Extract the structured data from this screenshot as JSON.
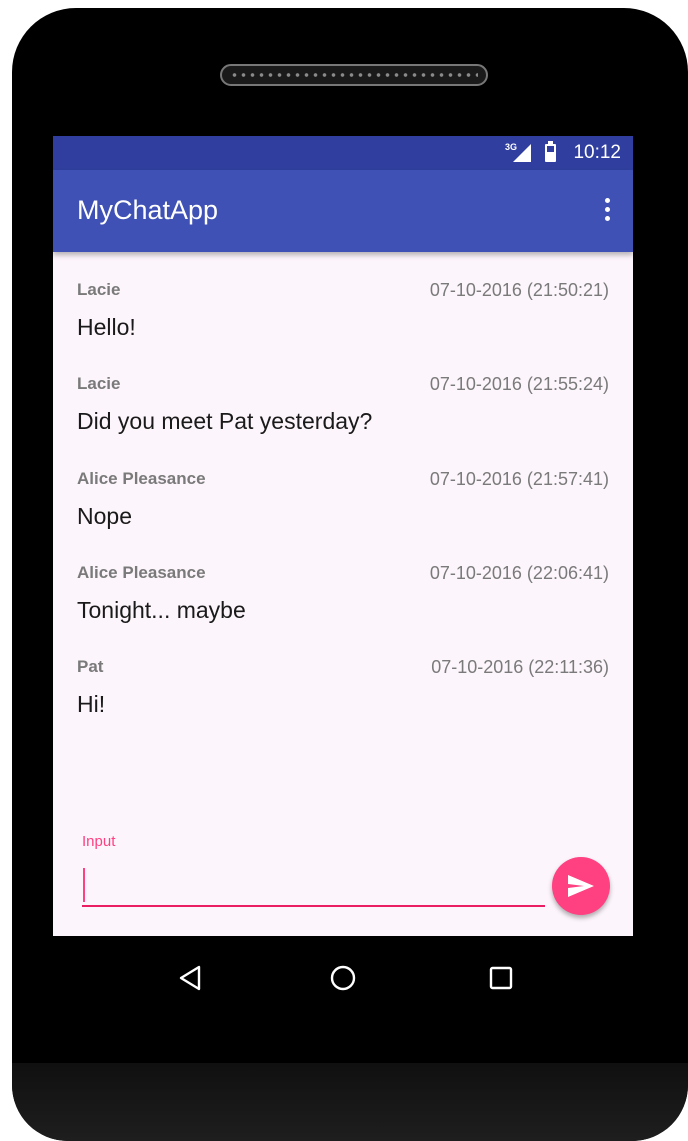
{
  "status_bar": {
    "network": "3G",
    "time": "10:12"
  },
  "app_bar": {
    "title": "MyChatApp",
    "overflow_icon": "more-vert-icon"
  },
  "messages": [
    {
      "sender": "Lacie",
      "timestamp": "07-10-2016 (21:50:21)",
      "text": "Hello!"
    },
    {
      "sender": "Lacie",
      "timestamp": "07-10-2016 (21:55:24)",
      "text": "Did you meet Pat yesterday?"
    },
    {
      "sender": "Alice Pleasance",
      "timestamp": "07-10-2016 (21:57:41)",
      "text": "Nope"
    },
    {
      "sender": "Alice Pleasance",
      "timestamp": "07-10-2016 (22:06:41)",
      "text": "Tonight... maybe"
    },
    {
      "sender": "Pat",
      "timestamp": "07-10-2016 (22:11:36)",
      "text": "Hi!"
    }
  ],
  "composer": {
    "label": "Input",
    "value": "",
    "send_icon": "send-icon"
  },
  "nav_bar": {
    "back_icon": "back-triangle-icon",
    "home_icon": "home-circle-icon",
    "recents_icon": "recents-square-icon"
  },
  "colors": {
    "status_bar": "#303f9f",
    "app_bar": "#3f51b5",
    "accent": "#ff4081",
    "background": "#fcf5fb"
  }
}
